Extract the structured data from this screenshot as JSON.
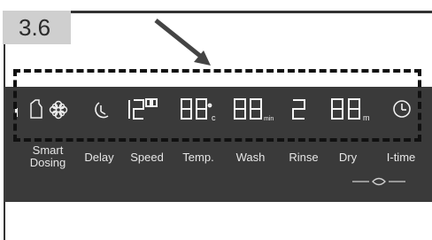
{
  "step": {
    "label": "3.6"
  },
  "display": {
    "labels": {
      "smart_dosing": "Smart Dosing",
      "delay": "Delay",
      "speed": "Speed",
      "temp": "Temp.",
      "wash": "Wash",
      "rinse": "Rinse",
      "dry": "Dry",
      "itime": "I-time"
    },
    "units": {
      "temp": "c",
      "wash": "min",
      "dry": "m"
    }
  },
  "icons": [
    "bottle-icon",
    "flower-icon",
    "delay-icon",
    "clock-icon",
    "steam-icon"
  ],
  "colors": {
    "panel": "#3a3a3a",
    "led": "#f0f0f0",
    "badge": "#cfcfcf"
  }
}
